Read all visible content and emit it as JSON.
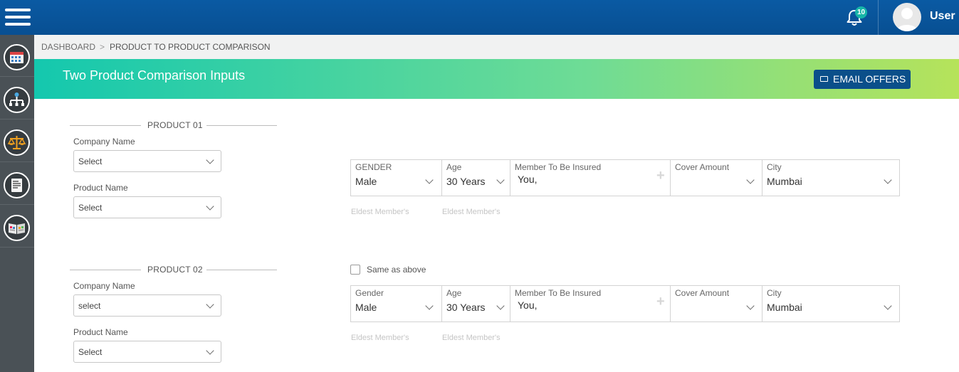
{
  "header": {
    "notifications_count": "10",
    "username": "User"
  },
  "sidebar": {
    "items": [
      {
        "icon": "calendar-icon"
      },
      {
        "icon": "org-chart-icon"
      },
      {
        "icon": "balance-scale-icon"
      },
      {
        "icon": "document-icon"
      },
      {
        "icon": "book-icon"
      }
    ]
  },
  "breadcrumb": {
    "home": "DASHBOARD",
    "separator": ">",
    "current": "PRODUCT TO PRODUCT COMPARISON"
  },
  "banner": {
    "title": "Two Product Comparison Inputs",
    "email_button": "EMAIL OFFERS"
  },
  "product1": {
    "title": "PRODUCT 01",
    "company_label": "Company Name",
    "company_value": "Select",
    "product_label": "Product Name",
    "product_value": "Select",
    "gender_label": "GENDER",
    "gender_value": "Male",
    "age_label": "Age",
    "age_value": "30 Years",
    "member_label": "Member To Be Insured",
    "member_value": "You,",
    "cover_label": "Cover Amount",
    "cover_value": "",
    "city_label": "City",
    "city_value": "Mumbai",
    "hint_gender": "Eldest Member's",
    "hint_age": "Eldest Member's"
  },
  "product2": {
    "title": "PRODUCT 02",
    "same_as_above": "Same as above",
    "company_label": "Company Name",
    "company_value": "select",
    "product_label": "Product Name",
    "product_value": "Select",
    "gender_label": "Gender",
    "gender_value": "Male",
    "age_label": "Age",
    "age_value": "30 Years",
    "member_label": "Member To Be Insured",
    "member_value": "You,",
    "cover_label": "Cover Amount",
    "cover_value": "",
    "city_label": "City",
    "city_value": "Mumbai",
    "hint_gender": "Eldest Member's",
    "hint_age": "Eldest Member's"
  },
  "colors": {
    "topbar": "#0a5aa3",
    "sidebar": "#4a5156",
    "accent_button": "#0b4f8a",
    "banner_start": "#14c8ae",
    "banner_end": "#b6e35a"
  }
}
